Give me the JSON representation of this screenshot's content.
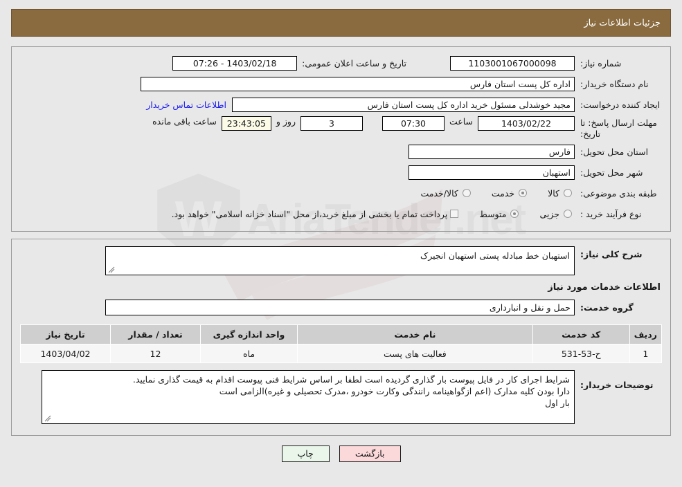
{
  "window": {
    "title": "جزئیات اطلاعات نیاز",
    "title_bar_color": "#8a6b3f",
    "page_bg": "#e8e8e8"
  },
  "watermark": {
    "text": "AriaTender.net",
    "icon": "shield-icon"
  },
  "form": {
    "need_number": {
      "label": "شماره نیاز:",
      "value": "1103001067000098"
    },
    "announce_datetime": {
      "label": "تاریخ و ساعت اعلان عمومی:",
      "value": "1403/02/18 - 07:26"
    },
    "buyer_org": {
      "label": "نام دستگاه خریدار:",
      "value": "اداره کل پست استان فارس"
    },
    "requester": {
      "label": "ایجاد کننده درخواست:",
      "value": "مجید خوشدلی مسئول خرید اداره کل پست استان فارس"
    },
    "buyer_contact_link": {
      "label": "اطلاعات تماس خریدار",
      "color": "#1a1aee"
    },
    "deadline": {
      "label": "مهلت ارسال پاسخ: تا تاریخ:",
      "date": "1403/02/22",
      "time_label": "ساعت",
      "time": "07:30",
      "days": "3",
      "days_label": "روز و",
      "countdown": "23:43:05",
      "countdown_label": "ساعت باقی مانده",
      "countdown_bg": "#fbfbe8"
    },
    "province": {
      "label": "استان محل تحویل:",
      "value": "فارس"
    },
    "city": {
      "label": "شهر محل تحویل:",
      "value": "استهبان"
    },
    "subject_category": {
      "label": "طبقه بندی موضوعی:",
      "options": [
        {
          "label": "کالا",
          "selected": false
        },
        {
          "label": "خدمت",
          "selected": true
        },
        {
          "label": "کالا/خدمت",
          "selected": false
        }
      ]
    },
    "purchase_type": {
      "label": "نوع فرآیند خرید :",
      "options": [
        {
          "label": "جزیی",
          "selected": false
        },
        {
          "label": "متوسط",
          "selected": true
        }
      ],
      "checkbox": {
        "label": "پرداخت تمام یا بخشی از مبلغ خرید،از محل \"اسناد خزانه اسلامی\" خواهد بود.",
        "checked": false
      }
    },
    "general_description": {
      "label": "شرح کلی نیاز:",
      "value": "استهبان خط مبادله پستی استهبان انجیرک"
    },
    "services_section_title": "اطلاعات خدمات مورد نیاز",
    "service_group": {
      "label": "گروه خدمت:",
      "value": "حمل و نقل و انبارداری"
    },
    "buyer_notes": {
      "label": "توضیحات خریدار:",
      "lines": [
        "شرایط اجرای کار در فایل پیوست بار گذاری گردیده است لطفا بر اساس شرایط فنی پیوست اقدام به قیمت گذاری نمایید.",
        "دارا بودن کلیه مدارک (اعم ازگواهینامه رانندگی وکارت خودرو ،مدرک تحصیلی و غیره)الزامی است",
        "بار اول"
      ]
    }
  },
  "table": {
    "headers": [
      "ردیف",
      "کد خدمت",
      "نام خدمت",
      "واحد اندازه گیری",
      "تعداد / مقدار",
      "تاریخ نیاز"
    ],
    "rows": [
      [
        "1",
        "ح-53-531",
        "فعالیت های پست",
        "ماه",
        "12",
        "1403/04/02"
      ]
    ]
  },
  "buttons": {
    "print": {
      "label": "چاپ",
      "bg": "#e9f6e9"
    },
    "back": {
      "label": "بازگشت",
      "bg": "#fbd8da"
    }
  }
}
